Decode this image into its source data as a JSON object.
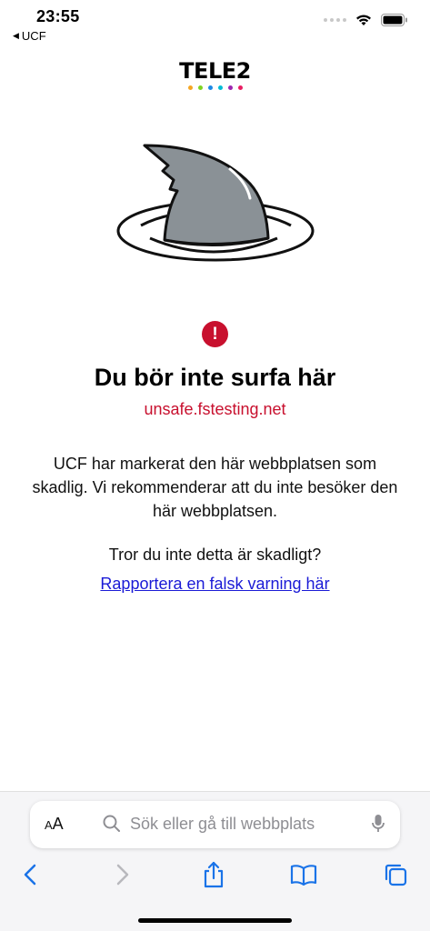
{
  "status_bar": {
    "time": "23:55",
    "back_app": "UCF"
  },
  "brand": {
    "logo_text": "TELE2",
    "logo_dot_colors": [
      "#f5a623",
      "#7ed321",
      "#1e88e5",
      "#00bcd4",
      "#9c27b0",
      "#e91e63"
    ]
  },
  "colors": {
    "danger": "#c8102e",
    "link": "#1a1ad6",
    "fin": "#8a9196"
  },
  "warning": {
    "icon_glyph": "!",
    "title": "Du bör inte surfa här",
    "url": "unsafe.fstesting.net",
    "description": "UCF har markerat den här webbplatsen som skadlig. Vi rekommenderar att du inte besöker den här webbplatsen.",
    "question": "Tror du inte detta är skadligt?",
    "report_link": "Rapportera en falsk varning här"
  },
  "browser": {
    "aa_label_small": "A",
    "aa_label_large": "A",
    "search_placeholder": "Sök eller gå till webbplats"
  },
  "icons": [
    "back-arrow-icon",
    "wifi-icon",
    "battery-icon",
    "search-icon",
    "microphone-icon",
    "chevron-left-icon",
    "chevron-right-icon",
    "share-icon",
    "bookmarks-icon",
    "tabs-icon",
    "warning-icon"
  ]
}
